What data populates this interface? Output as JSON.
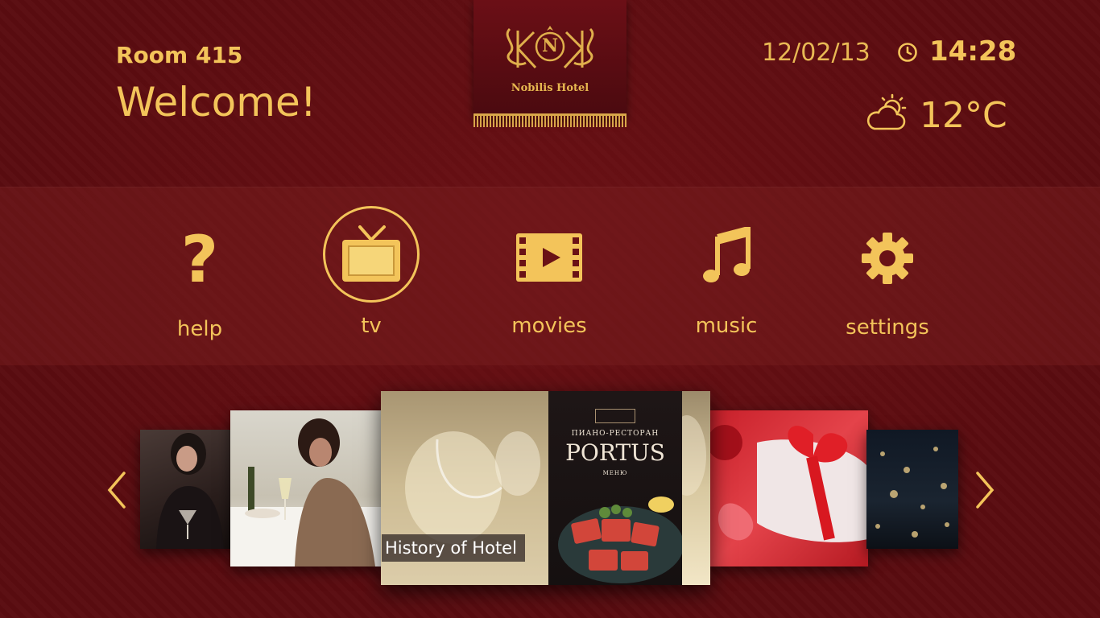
{
  "header": {
    "room": "Room 415",
    "welcome": "Welcome!",
    "date": "12/02/13",
    "time": "14:28",
    "temperature": "12°C",
    "weather_icon": "partly-cloudy-icon",
    "clock_icon": "clock-icon"
  },
  "logo": {
    "monogram": "N",
    "name": "Nobilis Hotel"
  },
  "menu": [
    {
      "label": "help",
      "icon": "question-icon"
    },
    {
      "label": "tv",
      "icon": "tv-icon",
      "selected": true
    },
    {
      "label": "movies",
      "icon": "film-play-icon"
    },
    {
      "label": "music",
      "icon": "music-note-icon"
    },
    {
      "label": "settings",
      "icon": "gear-icon"
    }
  ],
  "carousel": {
    "caption": "History of Hotel",
    "portus": {
      "subtitle": "ПИАНО-РЕСТОРАН",
      "title": "PORTUS",
      "menu_word": "МЕНЮ"
    }
  },
  "colors": {
    "accent": "#f3c45a",
    "background": "#5a0c10"
  }
}
